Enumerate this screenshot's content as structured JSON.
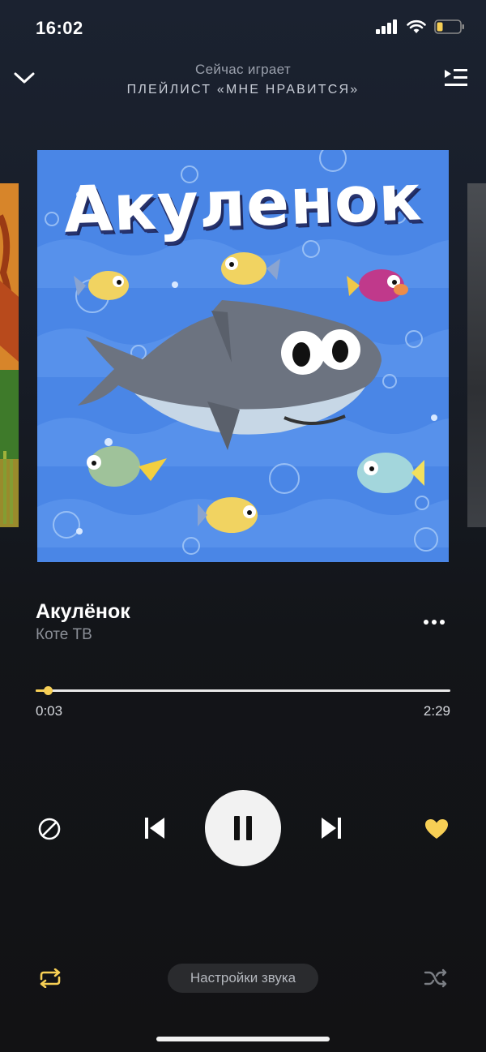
{
  "status_bar": {
    "time": "16:02",
    "battery_level": 0.25
  },
  "header": {
    "subtitle": "Сейчас играет",
    "title": "ПЛЕЙЛИСТ «МНЕ НРАВИТСЯ»"
  },
  "cover": {
    "title_text": "Акуленок"
  },
  "track": {
    "title": "Акулёнок",
    "artist": "Коте ТВ",
    "elapsed": "0:03",
    "duration": "2:29",
    "progress": 0.02
  },
  "controls": {
    "block_icon": "block-icon",
    "prev_icon": "skip-previous-icon",
    "play_state": "playing",
    "next_icon": "skip-next-icon",
    "liked": true
  },
  "footer": {
    "sound_settings_label": "Настройки звука"
  },
  "colors": {
    "accent": "#f7cf55",
    "background": "#131519",
    "cover_background": "#4a86e6"
  }
}
